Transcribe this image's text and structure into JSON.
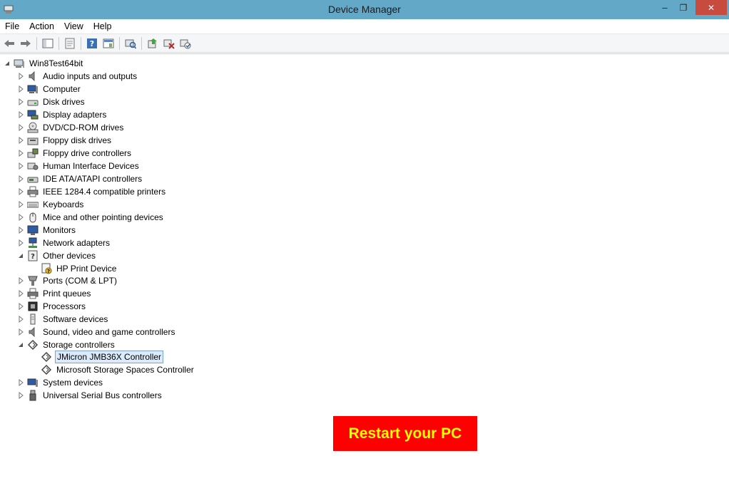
{
  "window": {
    "title": "Device Manager",
    "close_glyph": "✕",
    "maximize_glyph": "❐",
    "minimize_glyph": "–"
  },
  "menu": [
    "File",
    "Action",
    "View",
    "Help"
  ],
  "tree": {
    "root": "Win8Test64bit",
    "audio": "Audio inputs and outputs",
    "computer": "Computer",
    "disk": "Disk drives",
    "display": "Display adapters",
    "dvd": "DVD/CD-ROM drives",
    "floppy": "Floppy disk drives",
    "floppyctl": "Floppy drive controllers",
    "hid": "Human Interface Devices",
    "ide": "IDE ATA/ATAPI controllers",
    "ieee": "IEEE 1284.4 compatible printers",
    "keyboards": "Keyboards",
    "mice": "Mice and other pointing devices",
    "monitors": "Monitors",
    "network": "Network adapters",
    "other": "Other devices",
    "hp": "HP Print Device",
    "ports": "Ports (COM & LPT)",
    "printq": "Print queues",
    "processors": "Processors",
    "software": "Software devices",
    "sound": "Sound, video and game controllers",
    "storage": "Storage controllers",
    "jmicron": "JMicron JMB36X Controller",
    "msstorage": "Microsoft Storage Spaces Controller",
    "system": "System devices",
    "usb": "Universal Serial Bus controllers"
  },
  "overlay": {
    "restart": "Restart your PC"
  }
}
